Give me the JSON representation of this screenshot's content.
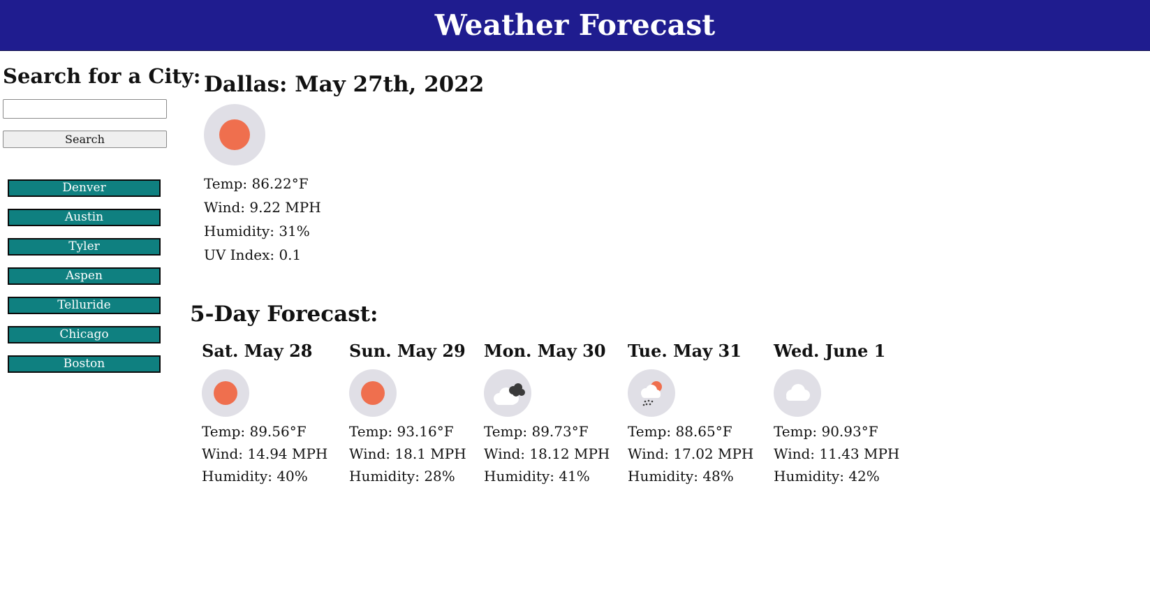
{
  "header": {
    "title": "Weather Forecast"
  },
  "sidebar": {
    "heading": "Search for a City:",
    "search": {
      "value": "",
      "placeholder": "",
      "button_label": "Search"
    },
    "cities": [
      "Denver",
      "Austin",
      "Tyler",
      "Aspen",
      "Telluride",
      "Chicago",
      "Boston"
    ]
  },
  "current": {
    "title": "Dallas: May 27th, 2022",
    "icon": "sun-icon",
    "temp": "Temp: 86.22°F",
    "wind": "Wind: 9.22 MPH",
    "humidity": "Humidity: 31%",
    "uv": "UV Index: 0.1"
  },
  "forecast": {
    "title": "5-Day Forecast:",
    "days": [
      {
        "date": "Sat. May 28",
        "icon": "sun-icon",
        "temp": "Temp: 89.56°F",
        "wind": "Wind: 14.94 MPH",
        "humidity": "Humidity: 40%"
      },
      {
        "date": "Sun. May 29",
        "icon": "sun-icon",
        "temp": "Temp: 93.16°F",
        "wind": "Wind: 18.1 MPH",
        "humidity": "Humidity: 28%"
      },
      {
        "date": "Mon. May 30",
        "icon": "dark-cloud-icon",
        "temp": "Temp: 89.73°F",
        "wind": "Wind: 18.12 MPH",
        "humidity": "Humidity: 41%"
      },
      {
        "date": "Tue. May 31",
        "icon": "sun-rain-cloud-icon",
        "temp": "Temp: 88.65°F",
        "wind": "Wind: 17.02 MPH",
        "humidity": "Humidity: 48%"
      },
      {
        "date": "Wed. June 1",
        "icon": "cloud-icon",
        "temp": "Temp: 90.93°F",
        "wind": "Wind: 11.43 MPH",
        "humidity": "Humidity: 42%"
      }
    ]
  },
  "colors": {
    "header_bg": "#1f1c8f",
    "city_btn_bg": "#0f8080",
    "sun": "#ef6f4e",
    "icon_bg": "#e0dfe6"
  }
}
